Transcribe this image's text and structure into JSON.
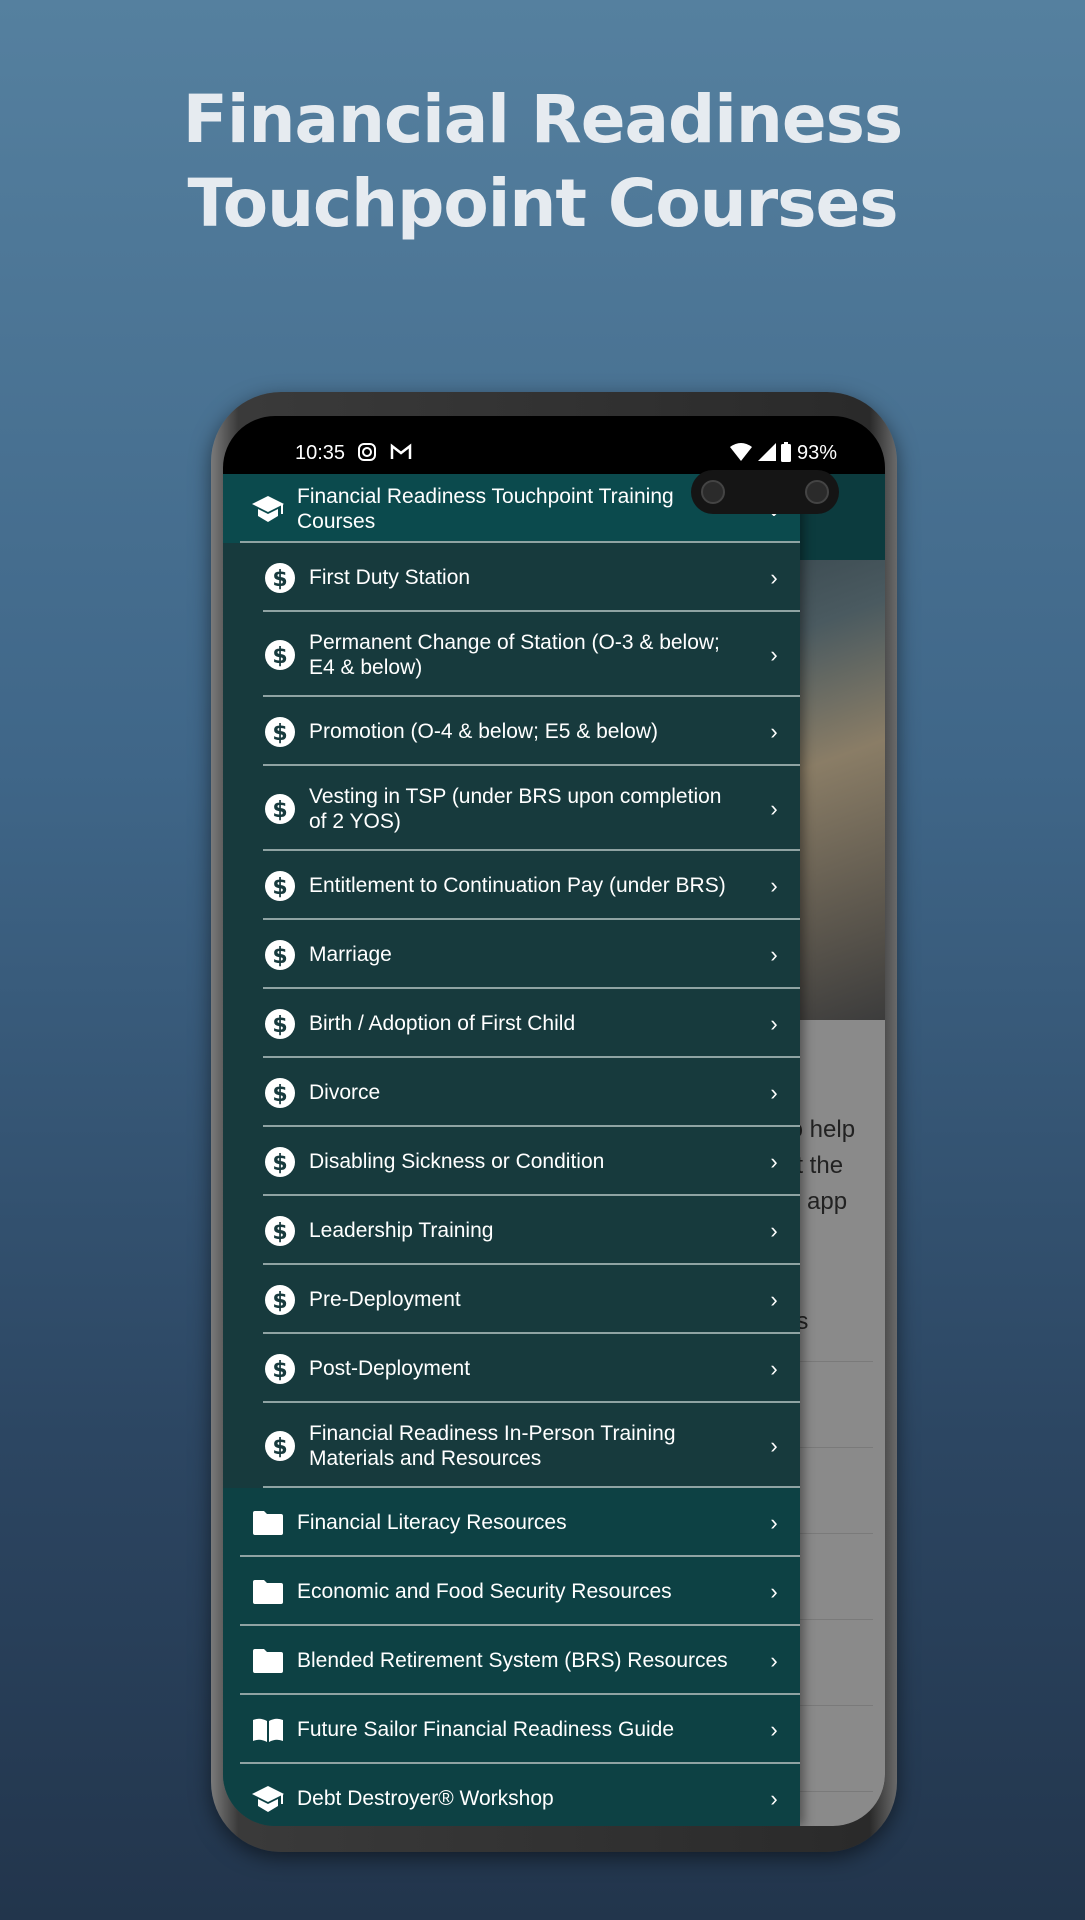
{
  "promo": {
    "title_line1": "Financial Readiness",
    "title_line2": "Touchpoint Courses"
  },
  "status_bar": {
    "time": "10:35",
    "battery": "93%",
    "icons": [
      "instagram-icon",
      "gmail-icon",
      "wifi-icon",
      "signal-icon",
      "battery-icon"
    ]
  },
  "background_content": {
    "lines": [
      "to help",
      "et the",
      "is app",
      "es"
    ]
  },
  "drawer": {
    "header": {
      "label": "Financial Readiness Touchpoint Training Courses",
      "icon": "graduation-cap-icon",
      "expanded": true
    },
    "sub_items": [
      {
        "label": "First Duty Station"
      },
      {
        "label": "Permanent Change of Station (O-3 & below; E4 & below)"
      },
      {
        "label": "Promotion (O-4 & below; E5 & below)"
      },
      {
        "label": "Vesting in TSP (under BRS upon completion of 2 YOS)"
      },
      {
        "label": "Entitlement to Continuation Pay (under BRS)"
      },
      {
        "label": "Marriage"
      },
      {
        "label": "Birth / Adoption of First Child"
      },
      {
        "label": "Divorce"
      },
      {
        "label": "Disabling Sickness or Condition"
      },
      {
        "label": "Leadership Training"
      },
      {
        "label": "Pre-Deployment"
      },
      {
        "label": "Post-Deployment"
      },
      {
        "label": "Financial Readiness In-Person Training Materials and Resources"
      }
    ],
    "top_items": [
      {
        "label": "Financial Literacy Resources",
        "icon": "folder-icon"
      },
      {
        "label": "Economic and Food Security Resources",
        "icon": "folder-icon"
      },
      {
        "label": "Blended Retirement System (BRS) Resources",
        "icon": "folder-icon"
      },
      {
        "label": "Future Sailor Financial Readiness Guide",
        "icon": "book-icon"
      },
      {
        "label": "Debt Destroyer® Workshop",
        "icon": "graduation-cap-icon"
      }
    ]
  },
  "colors": {
    "drawer_header": "#0b4a4d",
    "drawer_sub": "#173a3d",
    "drawer_top": "#0d4144"
  }
}
